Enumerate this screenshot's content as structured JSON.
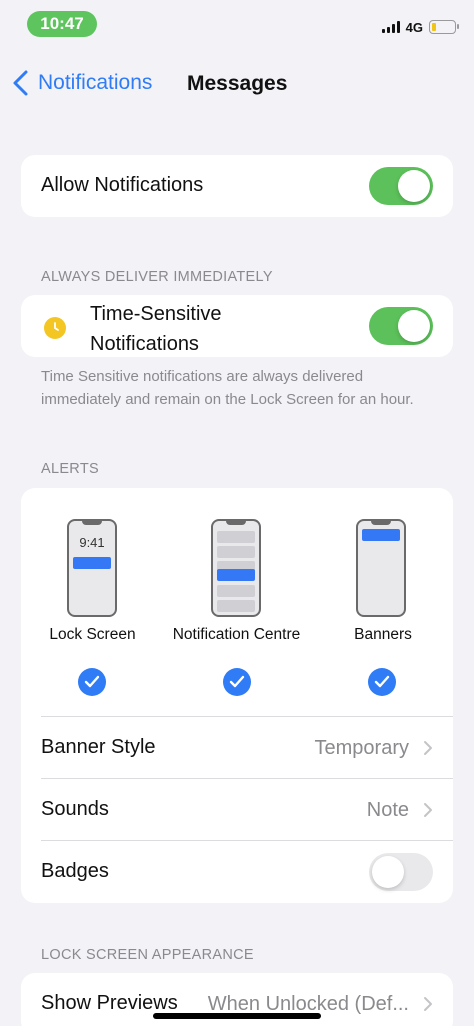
{
  "status_bar": {
    "time": "10:47",
    "network": "4G",
    "colors": {
      "time_pill": "#5ec55e",
      "battery_fill": "#f0c419"
    }
  },
  "nav": {
    "back_label": "Notifications",
    "title": "Messages"
  },
  "allow_notifications": {
    "label": "Allow Notifications",
    "enabled": true
  },
  "always_deliver": {
    "header": "ALWAYS DELIVER IMMEDIATELY",
    "time_sensitive_label_line1": "Time-Sensitive",
    "time_sensitive_label_line2": "Notifications",
    "time_sensitive_enabled": true,
    "icon": "clock-icon",
    "footnote": "Time Sensitive notifications are always delivered immediately and remain on the Lock Screen for an hour."
  },
  "alerts": {
    "header": "ALERTS",
    "lock_screen": {
      "label": "Lock Screen",
      "preview_time": "9:41",
      "checked": true
    },
    "notification_centre": {
      "label": "Notification Centre",
      "checked": true
    },
    "banners": {
      "label": "Banners",
      "checked": true
    },
    "banner_style": {
      "label": "Banner Style",
      "value": "Temporary"
    },
    "sounds": {
      "label": "Sounds",
      "value": "Note"
    },
    "badges": {
      "label": "Badges",
      "enabled": false
    }
  },
  "lock_screen_appearance": {
    "header": "LOCK SCREEN APPEARANCE",
    "show_previews": {
      "label": "Show Previews",
      "value": "When Unlocked (Def..."
    }
  },
  "colors": {
    "accent_blue": "#2f7cf6",
    "toggle_on": "#5cc15a",
    "toggle_off": "#e9e9eb",
    "background": "#f2f2f7",
    "secondary_text": "#8a8a8e"
  }
}
